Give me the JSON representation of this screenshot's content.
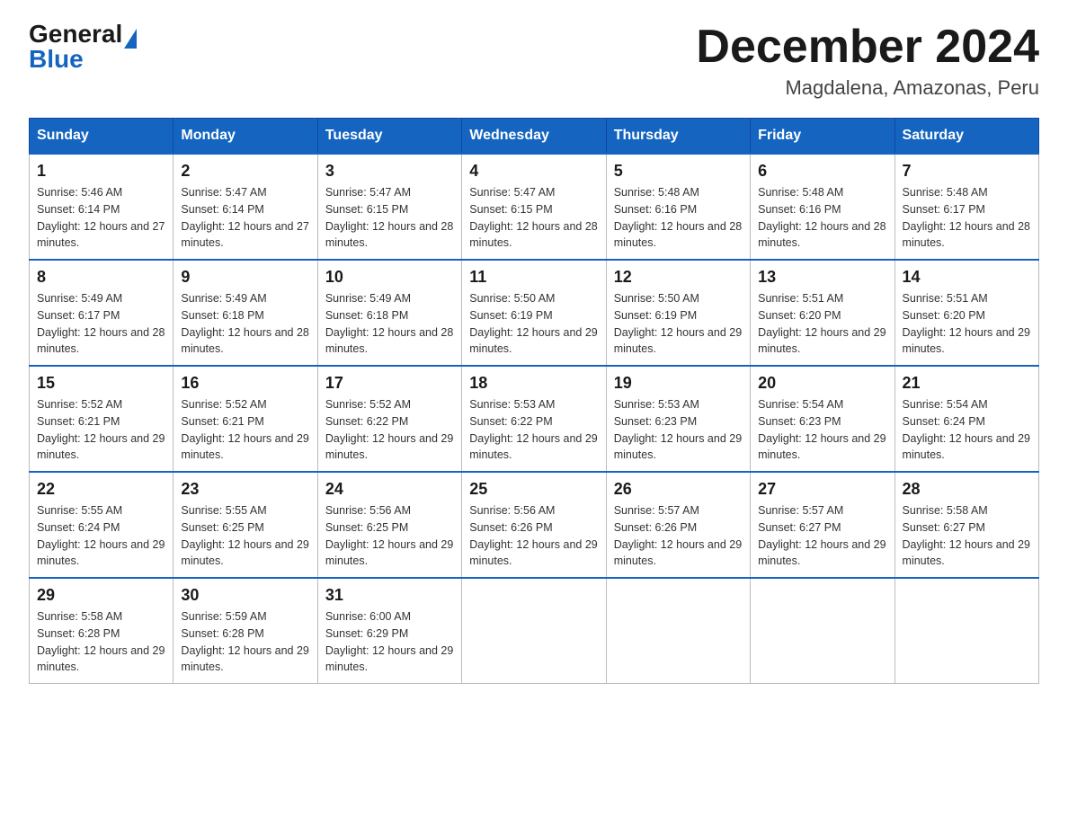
{
  "logo": {
    "general": "General",
    "blue": "Blue"
  },
  "title": "December 2024",
  "subtitle": "Magdalena, Amazonas, Peru",
  "days_of_week": [
    "Sunday",
    "Monday",
    "Tuesday",
    "Wednesday",
    "Thursday",
    "Friday",
    "Saturday"
  ],
  "weeks": [
    [
      {
        "day": "1",
        "sunrise": "5:46 AM",
        "sunset": "6:14 PM",
        "daylight": "12 hours and 27 minutes."
      },
      {
        "day": "2",
        "sunrise": "5:47 AM",
        "sunset": "6:14 PM",
        "daylight": "12 hours and 27 minutes."
      },
      {
        "day": "3",
        "sunrise": "5:47 AM",
        "sunset": "6:15 PM",
        "daylight": "12 hours and 28 minutes."
      },
      {
        "day": "4",
        "sunrise": "5:47 AM",
        "sunset": "6:15 PM",
        "daylight": "12 hours and 28 minutes."
      },
      {
        "day": "5",
        "sunrise": "5:48 AM",
        "sunset": "6:16 PM",
        "daylight": "12 hours and 28 minutes."
      },
      {
        "day": "6",
        "sunrise": "5:48 AM",
        "sunset": "6:16 PM",
        "daylight": "12 hours and 28 minutes."
      },
      {
        "day": "7",
        "sunrise": "5:48 AM",
        "sunset": "6:17 PM",
        "daylight": "12 hours and 28 minutes."
      }
    ],
    [
      {
        "day": "8",
        "sunrise": "5:49 AM",
        "sunset": "6:17 PM",
        "daylight": "12 hours and 28 minutes."
      },
      {
        "day": "9",
        "sunrise": "5:49 AM",
        "sunset": "6:18 PM",
        "daylight": "12 hours and 28 minutes."
      },
      {
        "day": "10",
        "sunrise": "5:49 AM",
        "sunset": "6:18 PM",
        "daylight": "12 hours and 28 minutes."
      },
      {
        "day": "11",
        "sunrise": "5:50 AM",
        "sunset": "6:19 PM",
        "daylight": "12 hours and 29 minutes."
      },
      {
        "day": "12",
        "sunrise": "5:50 AM",
        "sunset": "6:19 PM",
        "daylight": "12 hours and 29 minutes."
      },
      {
        "day": "13",
        "sunrise": "5:51 AM",
        "sunset": "6:20 PM",
        "daylight": "12 hours and 29 minutes."
      },
      {
        "day": "14",
        "sunrise": "5:51 AM",
        "sunset": "6:20 PM",
        "daylight": "12 hours and 29 minutes."
      }
    ],
    [
      {
        "day": "15",
        "sunrise": "5:52 AM",
        "sunset": "6:21 PM",
        "daylight": "12 hours and 29 minutes."
      },
      {
        "day": "16",
        "sunrise": "5:52 AM",
        "sunset": "6:21 PM",
        "daylight": "12 hours and 29 minutes."
      },
      {
        "day": "17",
        "sunrise": "5:52 AM",
        "sunset": "6:22 PM",
        "daylight": "12 hours and 29 minutes."
      },
      {
        "day": "18",
        "sunrise": "5:53 AM",
        "sunset": "6:22 PM",
        "daylight": "12 hours and 29 minutes."
      },
      {
        "day": "19",
        "sunrise": "5:53 AM",
        "sunset": "6:23 PM",
        "daylight": "12 hours and 29 minutes."
      },
      {
        "day": "20",
        "sunrise": "5:54 AM",
        "sunset": "6:23 PM",
        "daylight": "12 hours and 29 minutes."
      },
      {
        "day": "21",
        "sunrise": "5:54 AM",
        "sunset": "6:24 PM",
        "daylight": "12 hours and 29 minutes."
      }
    ],
    [
      {
        "day": "22",
        "sunrise": "5:55 AM",
        "sunset": "6:24 PM",
        "daylight": "12 hours and 29 minutes."
      },
      {
        "day": "23",
        "sunrise": "5:55 AM",
        "sunset": "6:25 PM",
        "daylight": "12 hours and 29 minutes."
      },
      {
        "day": "24",
        "sunrise": "5:56 AM",
        "sunset": "6:25 PM",
        "daylight": "12 hours and 29 minutes."
      },
      {
        "day": "25",
        "sunrise": "5:56 AM",
        "sunset": "6:26 PM",
        "daylight": "12 hours and 29 minutes."
      },
      {
        "day": "26",
        "sunrise": "5:57 AM",
        "sunset": "6:26 PM",
        "daylight": "12 hours and 29 minutes."
      },
      {
        "day": "27",
        "sunrise": "5:57 AM",
        "sunset": "6:27 PM",
        "daylight": "12 hours and 29 minutes."
      },
      {
        "day": "28",
        "sunrise": "5:58 AM",
        "sunset": "6:27 PM",
        "daylight": "12 hours and 29 minutes."
      }
    ],
    [
      {
        "day": "29",
        "sunrise": "5:58 AM",
        "sunset": "6:28 PM",
        "daylight": "12 hours and 29 minutes."
      },
      {
        "day": "30",
        "sunrise": "5:59 AM",
        "sunset": "6:28 PM",
        "daylight": "12 hours and 29 minutes."
      },
      {
        "day": "31",
        "sunrise": "6:00 AM",
        "sunset": "6:29 PM",
        "daylight": "12 hours and 29 minutes."
      },
      null,
      null,
      null,
      null
    ]
  ]
}
